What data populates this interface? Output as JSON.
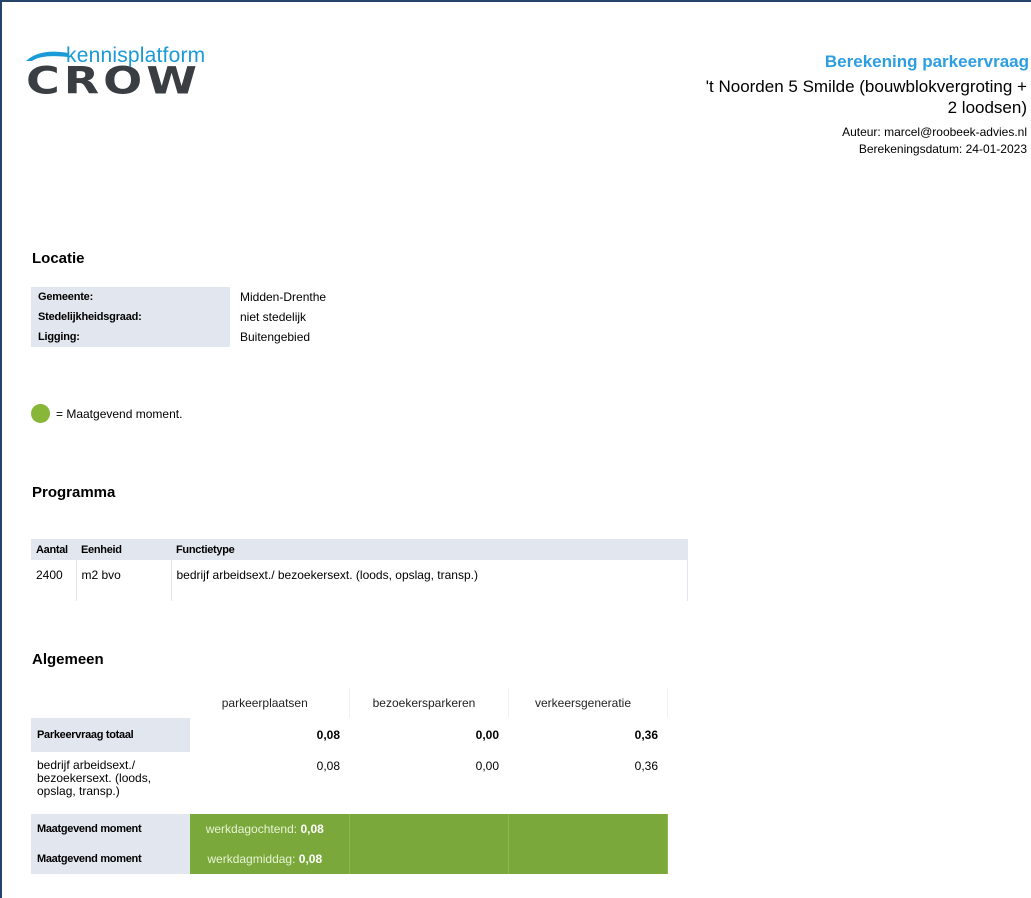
{
  "logo": {
    "top_text": "kennisplatform",
    "brand": "CROW"
  },
  "header": {
    "title": "Berekening parkeervraag",
    "project_line1": "'t Noorden 5 Smilde (bouwblokvergroting +",
    "project_line2": "2 loodsen)",
    "author": "Auteur: marcel@roobeek-advies.nl",
    "date": "Berekeningsdatum: 24-01-2023"
  },
  "locatie": {
    "heading": "Locatie",
    "rows": [
      {
        "key": "Gemeente:",
        "value": "Midden-Drenthe"
      },
      {
        "key": "Stedelijkheidsgraad:",
        "value": "niet stedelijk"
      },
      {
        "key": "Ligging:",
        "value": "Buitengebied"
      }
    ]
  },
  "legend": {
    "text": "= Maatgevend moment.",
    "color": "#87b638"
  },
  "programma": {
    "heading": "Programma",
    "columns": [
      "Aantal",
      "Eenheid",
      "Functietype"
    ],
    "rows": [
      {
        "aantal": "2400",
        "eenheid": "m2 bvo",
        "functietype": "bedrijf arbeidsext./ bezoekersext. (loods, opslag, transp.)"
      }
    ]
  },
  "algemeen": {
    "heading": "Algemeen",
    "columns": [
      "parkeerplaatsen",
      "bezoekersparkeren",
      "verkeersgeneratie"
    ],
    "totaal": {
      "label": "Parkeervraag totaal",
      "values": [
        "0,08",
        "0,00",
        "0,36"
      ]
    },
    "row": {
      "label_l1": "bedrijf arbeidsext./",
      "label_l2": "bezoekersext. (loods,",
      "label_l3": "opslag, transp.)",
      "values": [
        "0,08",
        "0,00",
        "0,36"
      ]
    },
    "maatgevend": [
      {
        "label": "Maatgevend moment",
        "moment": "werkdagochtend:",
        "value": "0,08"
      },
      {
        "label": "Maatgevend moment",
        "moment": "werkdagmiddag:",
        "value": "0,08"
      }
    ],
    "green": "#7aa83a"
  }
}
